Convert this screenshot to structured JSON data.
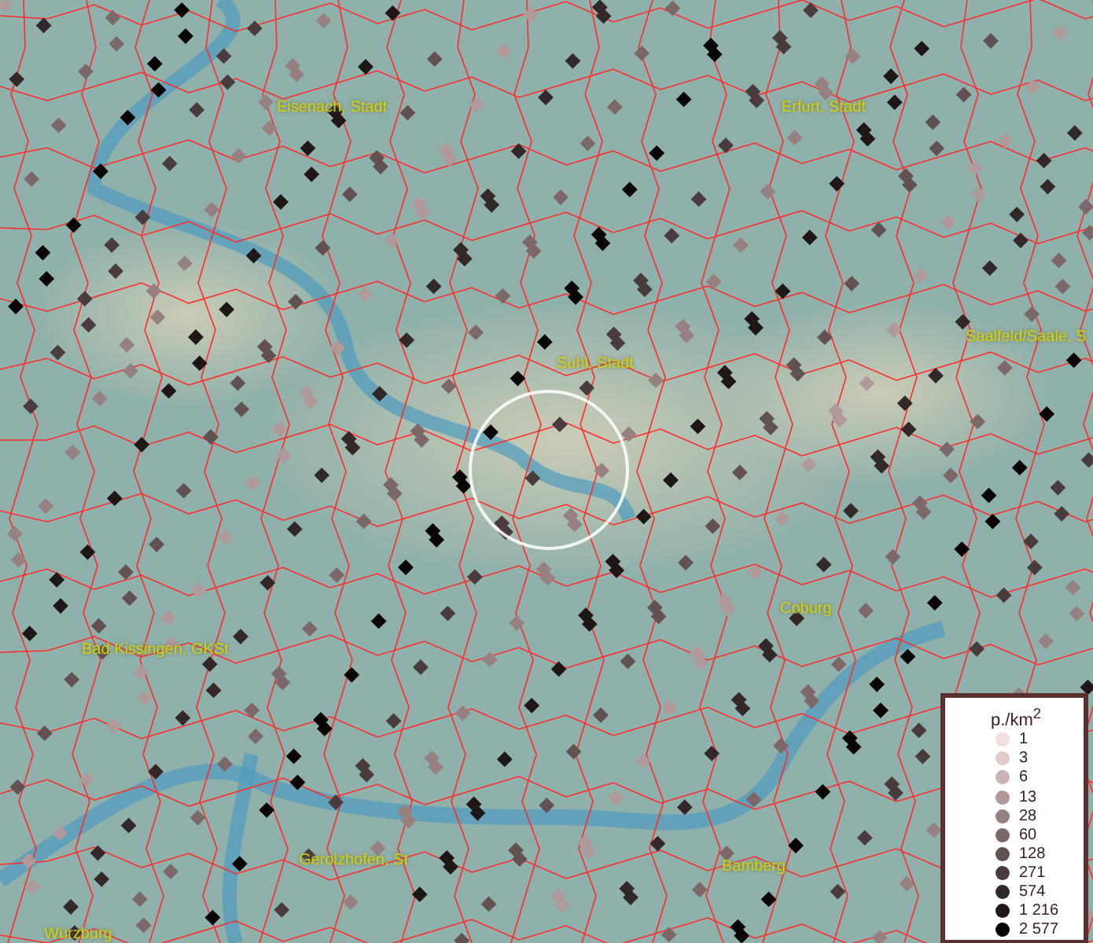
{
  "map": {
    "places": [
      {
        "name": "Eisenach, Stadt"
      },
      {
        "name": "Erfurt, Stadt"
      },
      {
        "name": "Suhl, Stadt"
      },
      {
        "name": "Saalfeld/Saale, S"
      },
      {
        "name": "Coburg"
      },
      {
        "name": "Bad Kissingen, GKSt"
      },
      {
        "name": "Gerolzhofen, St"
      },
      {
        "name": "Bamberg"
      },
      {
        "name": "Würzburg"
      }
    ]
  },
  "legend": {
    "title": "p./km$^{2}$",
    "items": [
      {
        "label": "1",
        "color": "#f2dede"
      },
      {
        "label": "3",
        "color": "#e2caca"
      },
      {
        "label": "6",
        "color": "#cbb3b3"
      },
      {
        "label": "13",
        "color": "#b09999"
      },
      {
        "label": "28",
        "color": "#978080"
      },
      {
        "label": "60",
        "color": "#7c6868"
      },
      {
        "label": "128",
        "color": "#625151"
      },
      {
        "label": "271",
        "color": "#4a3c3c"
      },
      {
        "label": "574",
        "color": "#332828"
      },
      {
        "label": "1 216",
        "color": "#1f1616"
      },
      {
        "label": "2 577",
        "color": "#0a0505"
      }
    ]
  }
}
